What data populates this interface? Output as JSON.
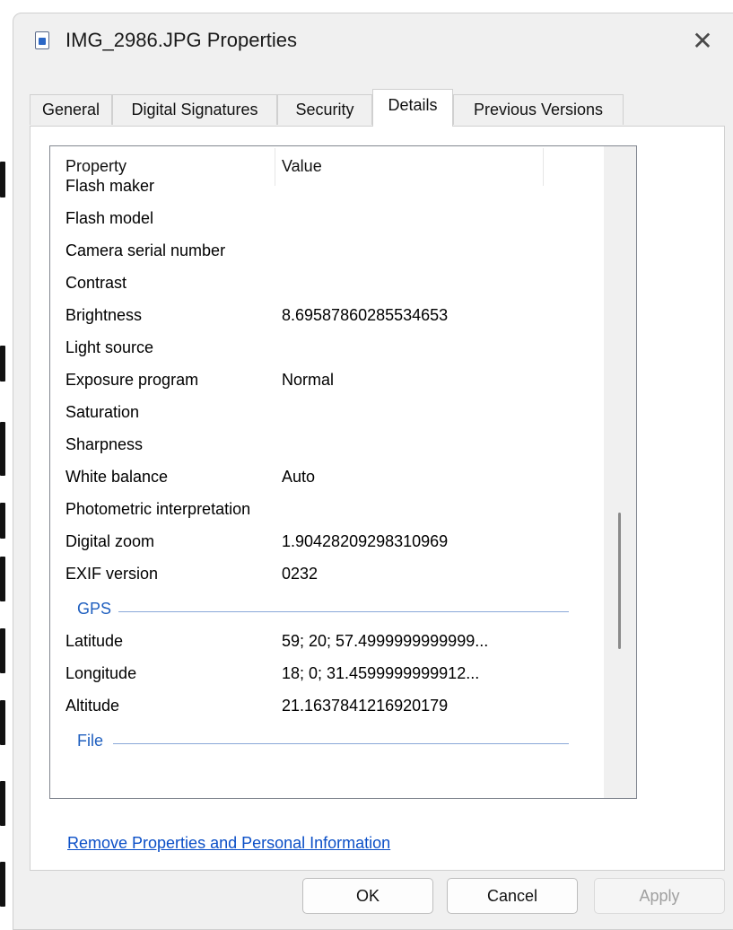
{
  "window": {
    "title": "IMG_2986.JPG Properties",
    "close_glyph": "✕"
  },
  "tabs": [
    {
      "label": "General"
    },
    {
      "label": "Digital Signatures"
    },
    {
      "label": "Security"
    },
    {
      "label": "Details"
    },
    {
      "label": "Previous Versions"
    }
  ],
  "active_tab": "Details",
  "table": {
    "header_property": "Property",
    "header_value": "Value",
    "rows": [
      {
        "property": "Flash maker",
        "value": ""
      },
      {
        "property": "Flash model",
        "value": ""
      },
      {
        "property": "Camera serial number",
        "value": ""
      },
      {
        "property": "Contrast",
        "value": ""
      },
      {
        "property": "Brightness",
        "value": "8.69587860285534653"
      },
      {
        "property": "Light source",
        "value": ""
      },
      {
        "property": "Exposure program",
        "value": "Normal"
      },
      {
        "property": "Saturation",
        "value": ""
      },
      {
        "property": "Sharpness",
        "value": ""
      },
      {
        "property": "White balance",
        "value": "Auto"
      },
      {
        "property": "Photometric interpretation",
        "value": ""
      },
      {
        "property": "Digital zoom",
        "value": "1.90428209298310969"
      },
      {
        "property": "EXIF version",
        "value": "0232"
      }
    ],
    "gps_group": "GPS",
    "gps_rows": [
      {
        "property": "Latitude",
        "value": "59; 20; 57.4999999999999..."
      },
      {
        "property": "Longitude",
        "value": "18; 0; 31.4599999999912..."
      },
      {
        "property": "Altitude",
        "value": "21.1637841216920179"
      }
    ],
    "file_group": "File"
  },
  "remove_link": "Remove Properties and Personal Information",
  "buttons": {
    "ok": "OK",
    "cancel": "Cancel",
    "apply": "Apply"
  },
  "colors": {
    "accent": "#1f5fbf",
    "link": "#0b4fc7"
  }
}
